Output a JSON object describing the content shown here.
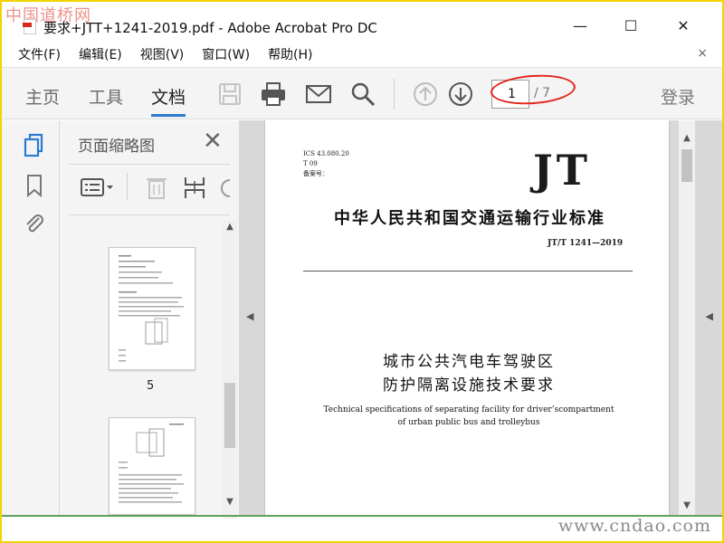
{
  "watermarks": {
    "top_left": "中国道桥网",
    "bottom_right": "www.cndao.com"
  },
  "window": {
    "title": "要求+JTT+1241-2019.pdf - Adobe Acrobat Pro DC",
    "minimize": "—",
    "maximize": "☐",
    "close": "✕"
  },
  "menu": {
    "items": [
      "文件(F)",
      "编辑(E)",
      "视图(V)",
      "窗口(W)",
      "帮助(H)"
    ],
    "close": "×"
  },
  "toolbar": {
    "tabs": [
      "主页",
      "工具",
      "文档"
    ],
    "active_tab": "文档",
    "icons": [
      "save-icon",
      "print-icon",
      "mail-icon",
      "search-icon",
      "page-up-icon",
      "page-down-icon"
    ],
    "current_page": "1",
    "total_pages": "/ 7",
    "login": "登录",
    "highlight_color": "#e3241b"
  },
  "rail": {
    "icons": [
      "page-thumbnails-icon",
      "bookmark-icon",
      "attachment-icon"
    ],
    "accent": "#2d7ad1"
  },
  "thumbnails": {
    "title": "页面缩略图",
    "close": "✕",
    "tool_icons": [
      "options-icon",
      "delete-icon",
      "insert-icon",
      "rotate-icon"
    ],
    "visible_page_label": "5"
  },
  "document": {
    "ics_lines": [
      "ICS 43.080.20",
      "T 09",
      "备案号："
    ],
    "logo": "JT",
    "standard_title": "中华人民共和国交通运输行业标准",
    "standard_code": "JT/T 1241—2019",
    "cn_title_line1": "城市公共汽电车驾驶区",
    "cn_title_line2": "防护隔离设施技术要求",
    "en_title_line1": "Technical specifications of separating facility for driver’scompartment",
    "en_title_line2": "of urban public bus and trolleybus"
  }
}
